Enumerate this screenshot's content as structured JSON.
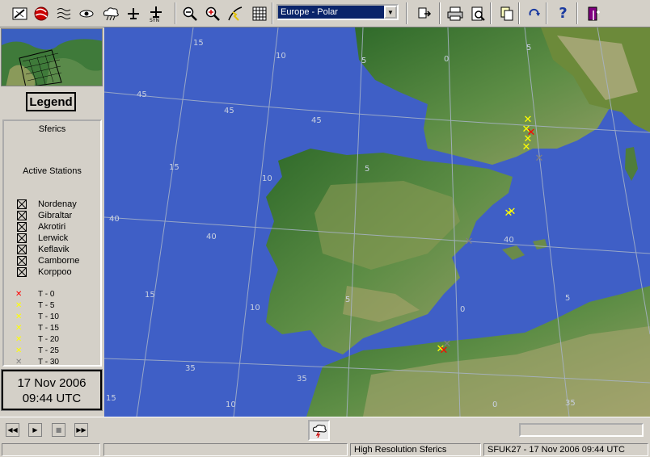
{
  "toolbar": {
    "region_value": "Europe - Polar",
    "icons": [
      "draw-icon",
      "storm-icon",
      "contour-icon",
      "eye-icon",
      "cloud-icon",
      "aircraft-icon",
      "synop-icon",
      "zoom-out-icon",
      "zoom-in-icon",
      "lightning-track-icon",
      "grid-icon",
      "export-icon",
      "print-icon",
      "print-preview-icon",
      "copy-icon",
      "refresh-icon",
      "help-icon",
      "exit-icon"
    ]
  },
  "legend": {
    "title": "Legend",
    "section": "Sferics",
    "stations_heading": "Active Stations",
    "stations": [
      "Nordenay",
      "Gibraltar",
      "Akrotiri",
      "Lerwick",
      "Keflavik",
      "Camborne",
      "Korppoo"
    ],
    "time_keys": [
      {
        "label": "T - 0",
        "color": "#ff0000"
      },
      {
        "label": "T - 5",
        "color": "#ffff00"
      },
      {
        "label": "T - 10",
        "color": "#ffff00"
      },
      {
        "label": "T - 15",
        "color": "#ffff00"
      },
      {
        "label": "T - 20",
        "color": "#ffff00"
      },
      {
        "label": "T - 25",
        "color": "#ffff00"
      },
      {
        "label": "T - 30",
        "color": "#808080"
      }
    ]
  },
  "datetime": {
    "date": "17 Nov 2006",
    "time": "09:44 UTC"
  },
  "map": {
    "lat_labels": [
      "45",
      "45",
      "45",
      "40",
      "40",
      "40",
      "35",
      "35",
      "35"
    ],
    "lon_labels": [
      "15",
      "10",
      "5",
      "0",
      "5",
      "15",
      "10",
      "5",
      "15",
      "10",
      "5",
      "0",
      "5",
      "15",
      "10",
      "0"
    ]
  },
  "status": {
    "pane1": "",
    "pane2": "",
    "product": "High Resolution Sferics",
    "info": "SFUK27 - 17 Nov 2006 09:44 UTC"
  }
}
